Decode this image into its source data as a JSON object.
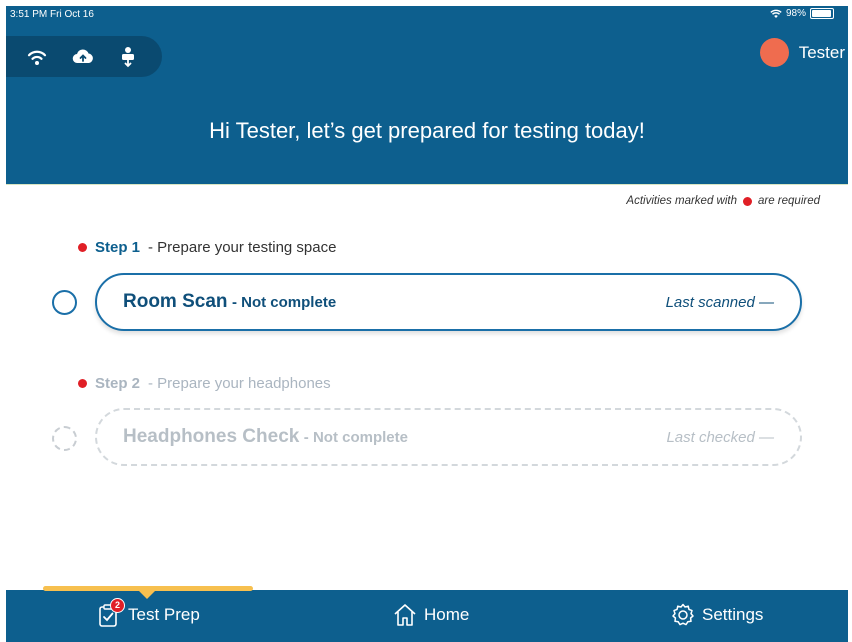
{
  "status_bar": {
    "time_date": "3:51 PM  Fri Oct 16",
    "battery": "98%"
  },
  "header": {
    "connection_icons": [
      "wifi-icon",
      "cloud-upload-icon",
      "usb-icon"
    ],
    "user_name": "Tester",
    "greeting": "Hi Tester, let’s get prepared for testing today!"
  },
  "required_note": {
    "prefix": "Activities marked with",
    "suffix": "are required"
  },
  "steps": [
    {
      "step_num": "Step 1",
      "description": "- Prepare your testing space",
      "activity": {
        "title": "Room Scan",
        "status": "- Not complete",
        "meta": "Last scanned  —"
      }
    },
    {
      "step_num": "Step 2",
      "description": "- Prepare your headphones",
      "activity": {
        "title": "Headphones Check",
        "status": "- Not complete",
        "meta": "Last checked  —"
      }
    }
  ],
  "bottom_nav": {
    "items": [
      {
        "label": "Test Prep",
        "icon": "clipboard-check-icon",
        "badge": "2"
      },
      {
        "label": "Home",
        "icon": "home-icon"
      },
      {
        "label": "Settings",
        "icon": "gear-icon"
      }
    ],
    "active": "Test Prep"
  },
  "colors": {
    "header_bg": "#0d5f8e",
    "accent": "#1a6fa8",
    "required_dot": "#e01f26",
    "avatar": "#ef6c4f",
    "tab_indicator": "#f7c04f"
  }
}
